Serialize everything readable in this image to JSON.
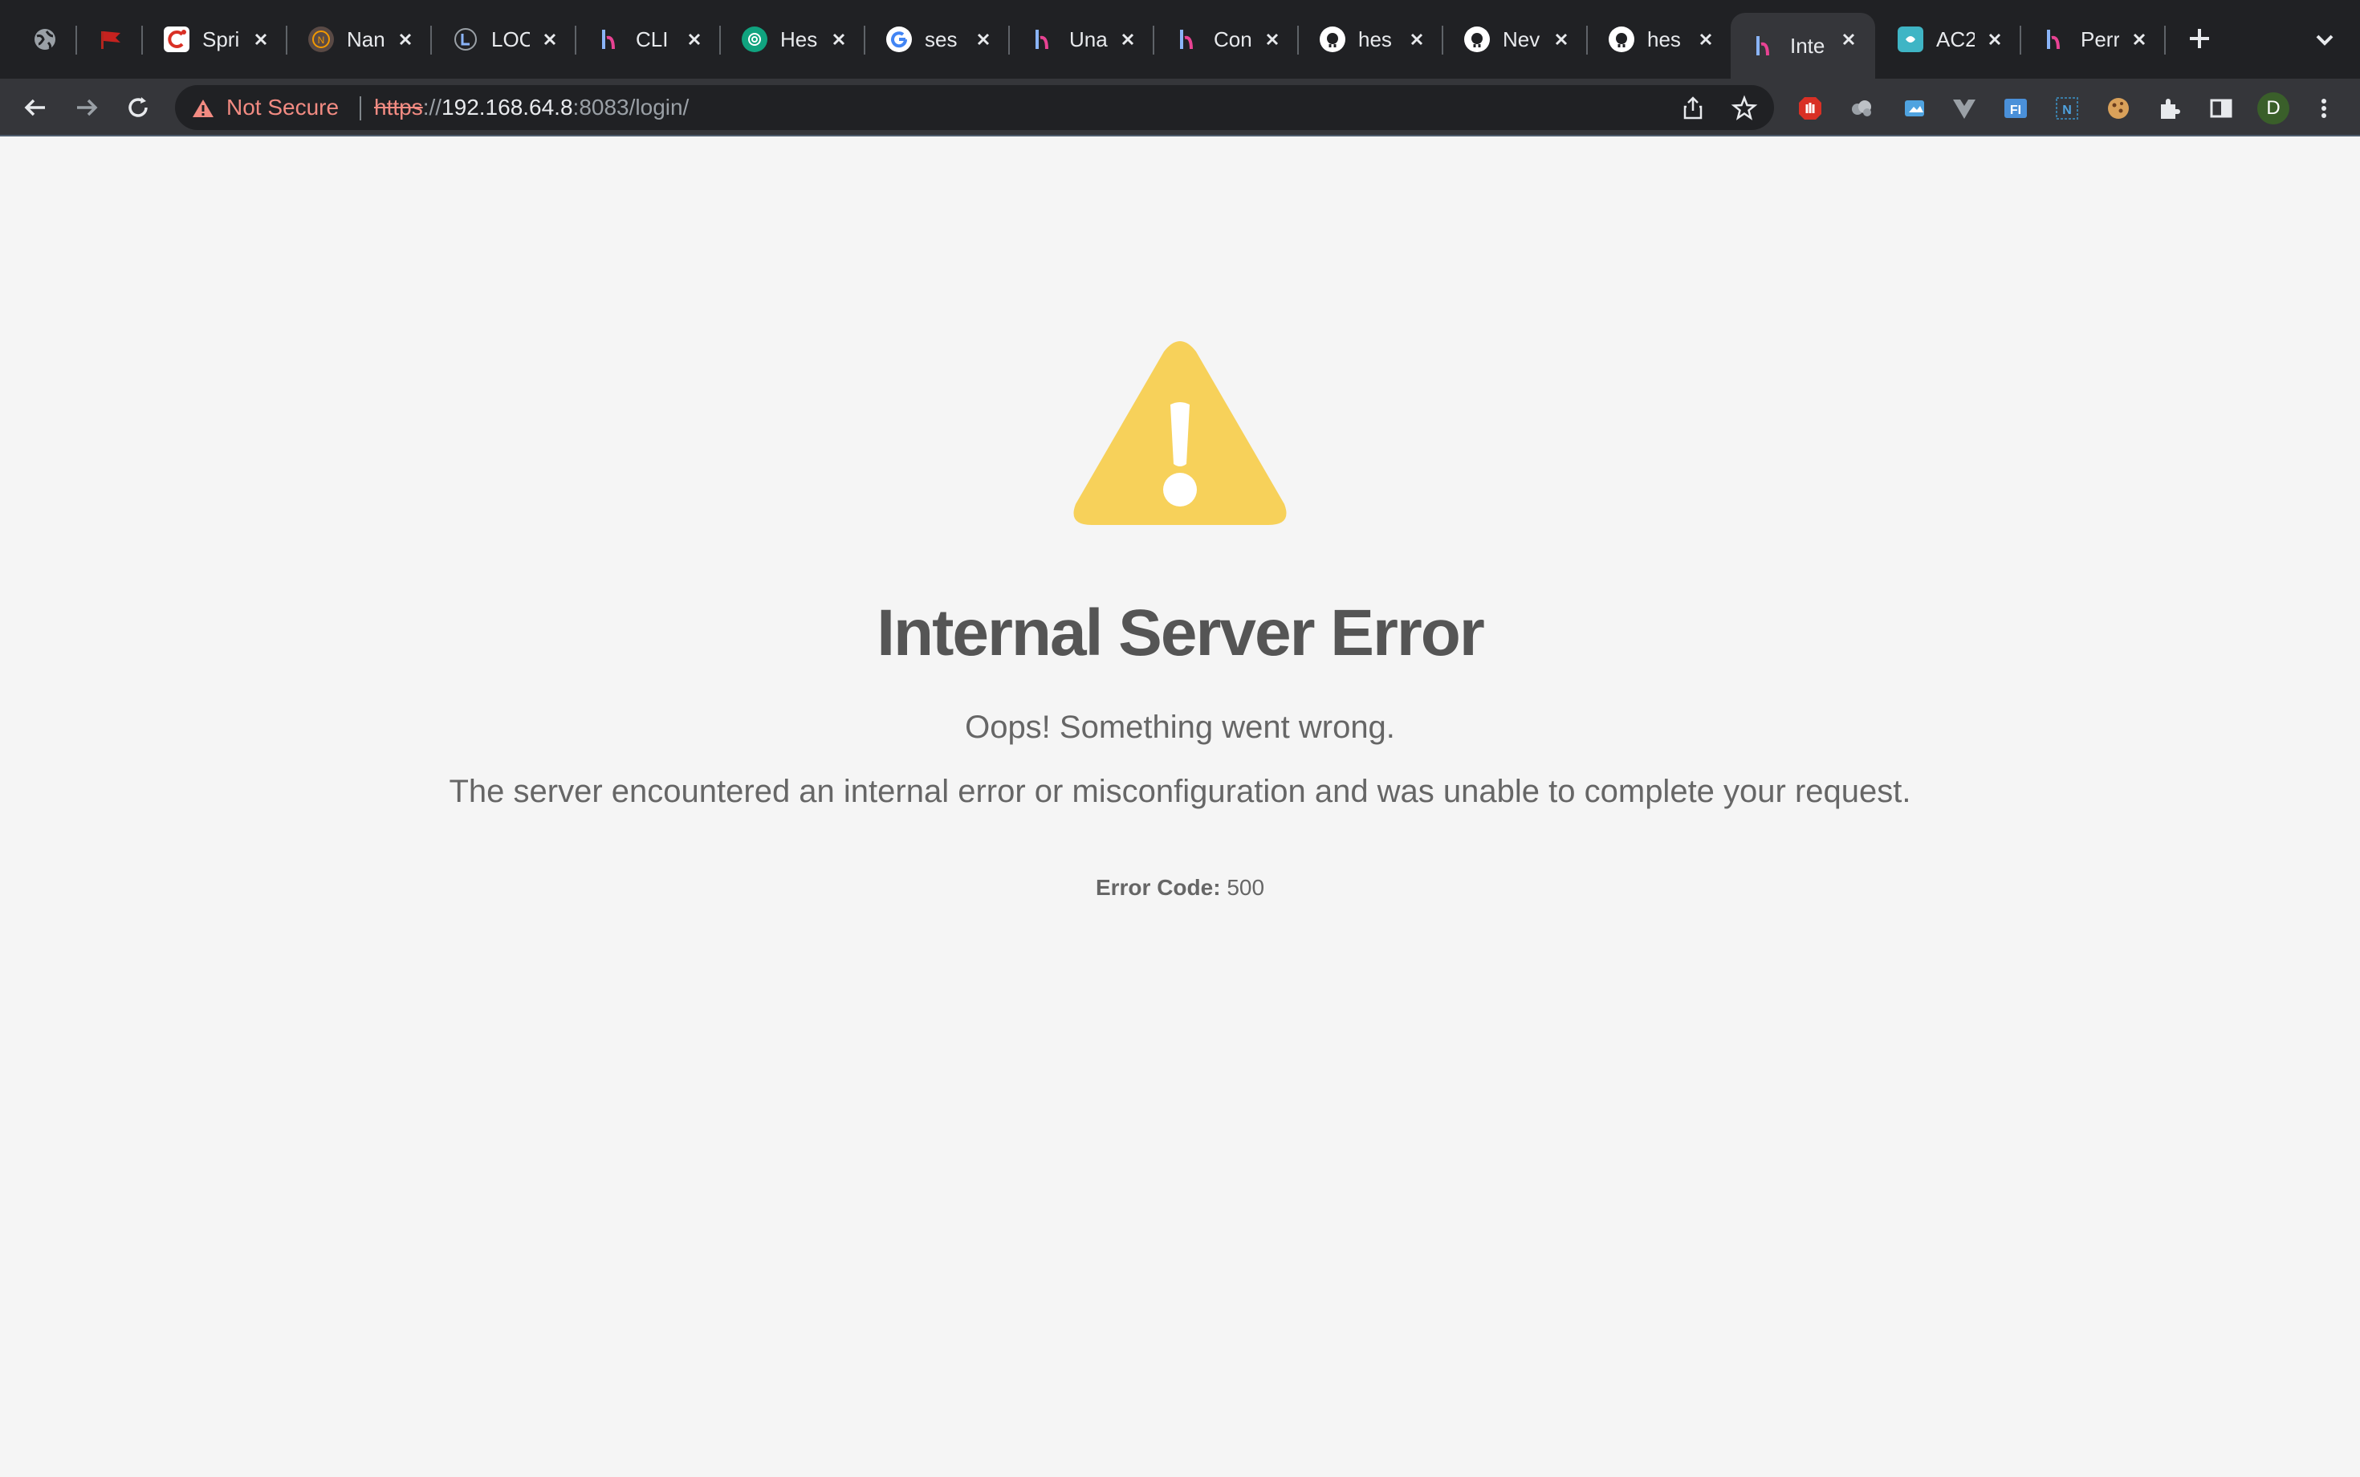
{
  "browser": {
    "tabs": [
      {
        "title": "",
        "icon": "globe-icon"
      },
      {
        "title": "",
        "icon": "red-flag-icon"
      },
      {
        "title": "Spri",
        "icon": "spring-icon"
      },
      {
        "title": "Nan",
        "icon": "nano-icon"
      },
      {
        "title": "LOC",
        "icon": "loc-icon"
      },
      {
        "title": "CLI",
        "icon": "hesk-icon"
      },
      {
        "title": "Hes",
        "icon": "openai-icon"
      },
      {
        "title": "ses",
        "icon": "google-icon"
      },
      {
        "title": "Una",
        "icon": "hesk-icon"
      },
      {
        "title": "Con",
        "icon": "hesk-icon"
      },
      {
        "title": "hes",
        "icon": "github-icon"
      },
      {
        "title": "Nev",
        "icon": "github-icon"
      },
      {
        "title": "hes",
        "icon": "github-icon"
      },
      {
        "title": "Inte",
        "icon": "hesk-icon",
        "active": true
      },
      {
        "title": "AC2",
        "icon": "ac2-icon"
      },
      {
        "title": "Perr",
        "icon": "hesk-icon"
      }
    ],
    "security_label": "Not Secure",
    "url": {
      "scheme": "https",
      "sep": "://",
      "host": "192.168.64.8",
      "rest": ":8083/login/"
    },
    "profile_initial": "D",
    "colors": {
      "tabstrip": "#202124",
      "toolbar": "#35363a",
      "omnibox": "#202124",
      "danger": "#f28b82",
      "profile": "#3a5f2a"
    }
  },
  "page": {
    "title": "Internal Server Error",
    "subtitle": "Oops! Something went wrong.",
    "message": "The server encountered an internal error or misconfiguration and was unable to complete your request.",
    "error_code_label": "Error Code:",
    "error_code_value": "500",
    "icon": "warning-triangle-icon",
    "colors": {
      "background": "#f5f5f5",
      "warning": "#f7d15a",
      "text": "#555555"
    }
  }
}
